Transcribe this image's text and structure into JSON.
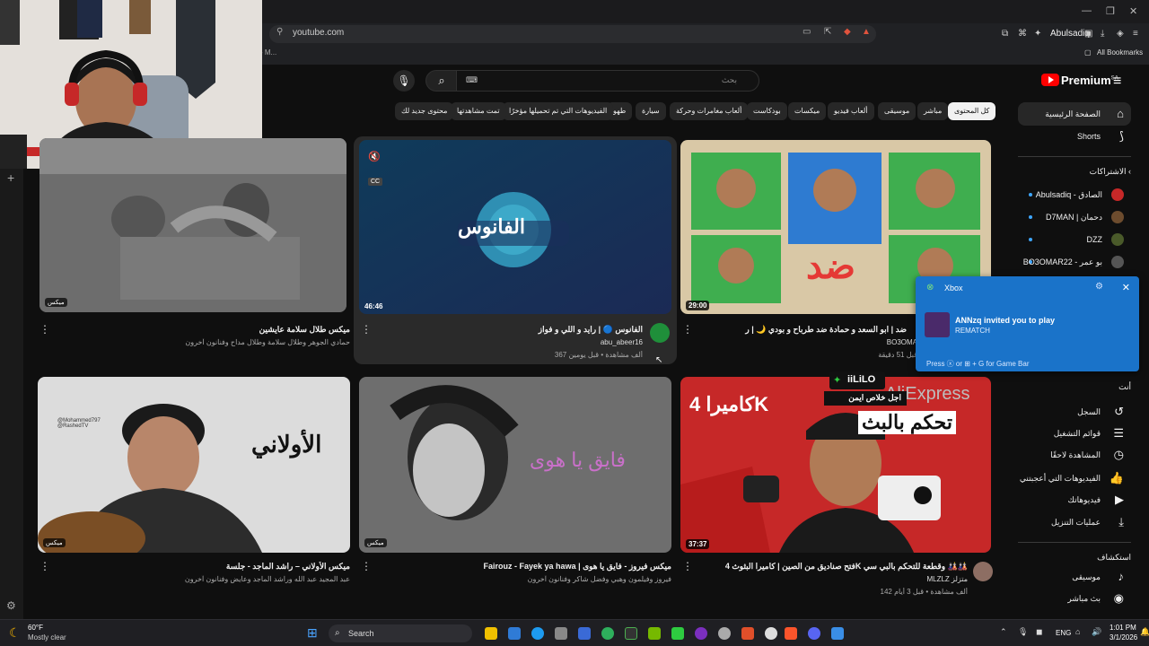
{
  "browser": {
    "url": "youtube.com",
    "bookmarks_label": "All Bookmarks",
    "left_tab_fragment": "- M...",
    "subscription_title": "Abulsadiq"
  },
  "header": {
    "logo": "Premium",
    "logo_sup": "SA",
    "search_placeholder": "بحث"
  },
  "chips": [
    "كل المحتوى",
    "مباشر",
    "موسيقى",
    "ألعاب فيديو",
    "ميكسات",
    "بودكاست",
    "ألعاب مغامرات وحركة",
    "سيارة",
    "طهو",
    "الفيديوهات التي تم تحميلها مؤخرًا",
    "تمت مشاهدتها",
    "محتوى جديد لك"
  ],
  "sidebar": {
    "home": "الصفحة الرئيسية",
    "shorts": "Shorts",
    "subscriptions_heading": "الاشتراكات",
    "subscriptions": [
      {
        "name": "Abulsadiq - الصادق",
        "color": "#c62828"
      },
      {
        "name": "D7MAN | دحمان",
        "color": "#6d4c2e"
      },
      {
        "name": "DZZ",
        "color": "#4a5a2a"
      },
      {
        "name": "BO3OMAR22 - بو عمر",
        "color": "#555555"
      }
    ],
    "you_heading": "أنت",
    "history": "السجل",
    "playlists": "قوائم التشغيل",
    "watch_later": "المشاهدة لاحقًا",
    "liked": "الفيديوهات التي أعجبتني",
    "your_videos": "فيديوهاتك",
    "downloads": "عمليات التنزيل",
    "explore_heading": "استكشاف",
    "music": "موسيقى",
    "live": "بث مباشر"
  },
  "videos": [
    {
      "title": "ميكس طلال سلامة عايشين",
      "meta": "حمادي الجوهر وطلال سلامة وطلال مداح وفنانون آخرون",
      "badge": "ميكس"
    },
    {
      "title": "الفانوس 🔵 | رايد و اللي و فواز",
      "channel": "abu_abeer16",
      "stats": "367 ألف مشاهدة • قبل يومين",
      "logo": "الفانوس",
      "duration": "46:46"
    },
    {
      "title": "ضد | ابو السعد و حمادة ضد طرباح و بودي 🌙 | ر",
      "channel": "BO3OMA",
      "stats": "قبل 51 دقيقة",
      "big_text": "ضد",
      "duration": "29:00"
    },
    {
      "title": "ميكس الأولاني – راشد الماجد - جلسة",
      "meta": "عبد المجيد عبد الله وراشد الماجد وعايض وفنانون آخرون",
      "badge": "ميكس",
      "thumb_text": "الأولاني",
      "handle": "@Mohammed797 @RashedTV"
    },
    {
      "title": "Fairouz - Fayek ya hawa | ميكس فيروز - فايق يا هوى",
      "meta": "فيروز وفيلمون وهبي وفضل شاكر وفنانون آخرون",
      "badge": "ميكس",
      "thumb_text": "فايق يا هوى"
    },
    {
      "title": "فتح صناديق من الصين | كاميرا البثوث 4K وقطعة للتحكم بالبي سي 🎎🎎",
      "channel": "MLZLZ متزلز",
      "stats": "142 ألف مشاهدة • قبل 3 أيام",
      "thumb_top": "كاميرا 4K",
      "thumb_bottom": "تحكم بالبث",
      "duration": "37:37"
    }
  ],
  "overlays": {
    "aliexpress": "AliExpress",
    "ililo": "iiLiLO",
    "ililo_sub": "اجل خلاص ايمن"
  },
  "xbox": {
    "app": "Xbox",
    "message": "ANNzq invited you to play",
    "game": "REMATCH",
    "footer": "Press ⓧ or ⊞ + G for Game Bar"
  },
  "taskbar": {
    "temp": "60°F",
    "weather": "Mostly clear",
    "search": "Search",
    "lang": "ENG",
    "time": "1:01 PM",
    "date": "3/1/2026"
  }
}
